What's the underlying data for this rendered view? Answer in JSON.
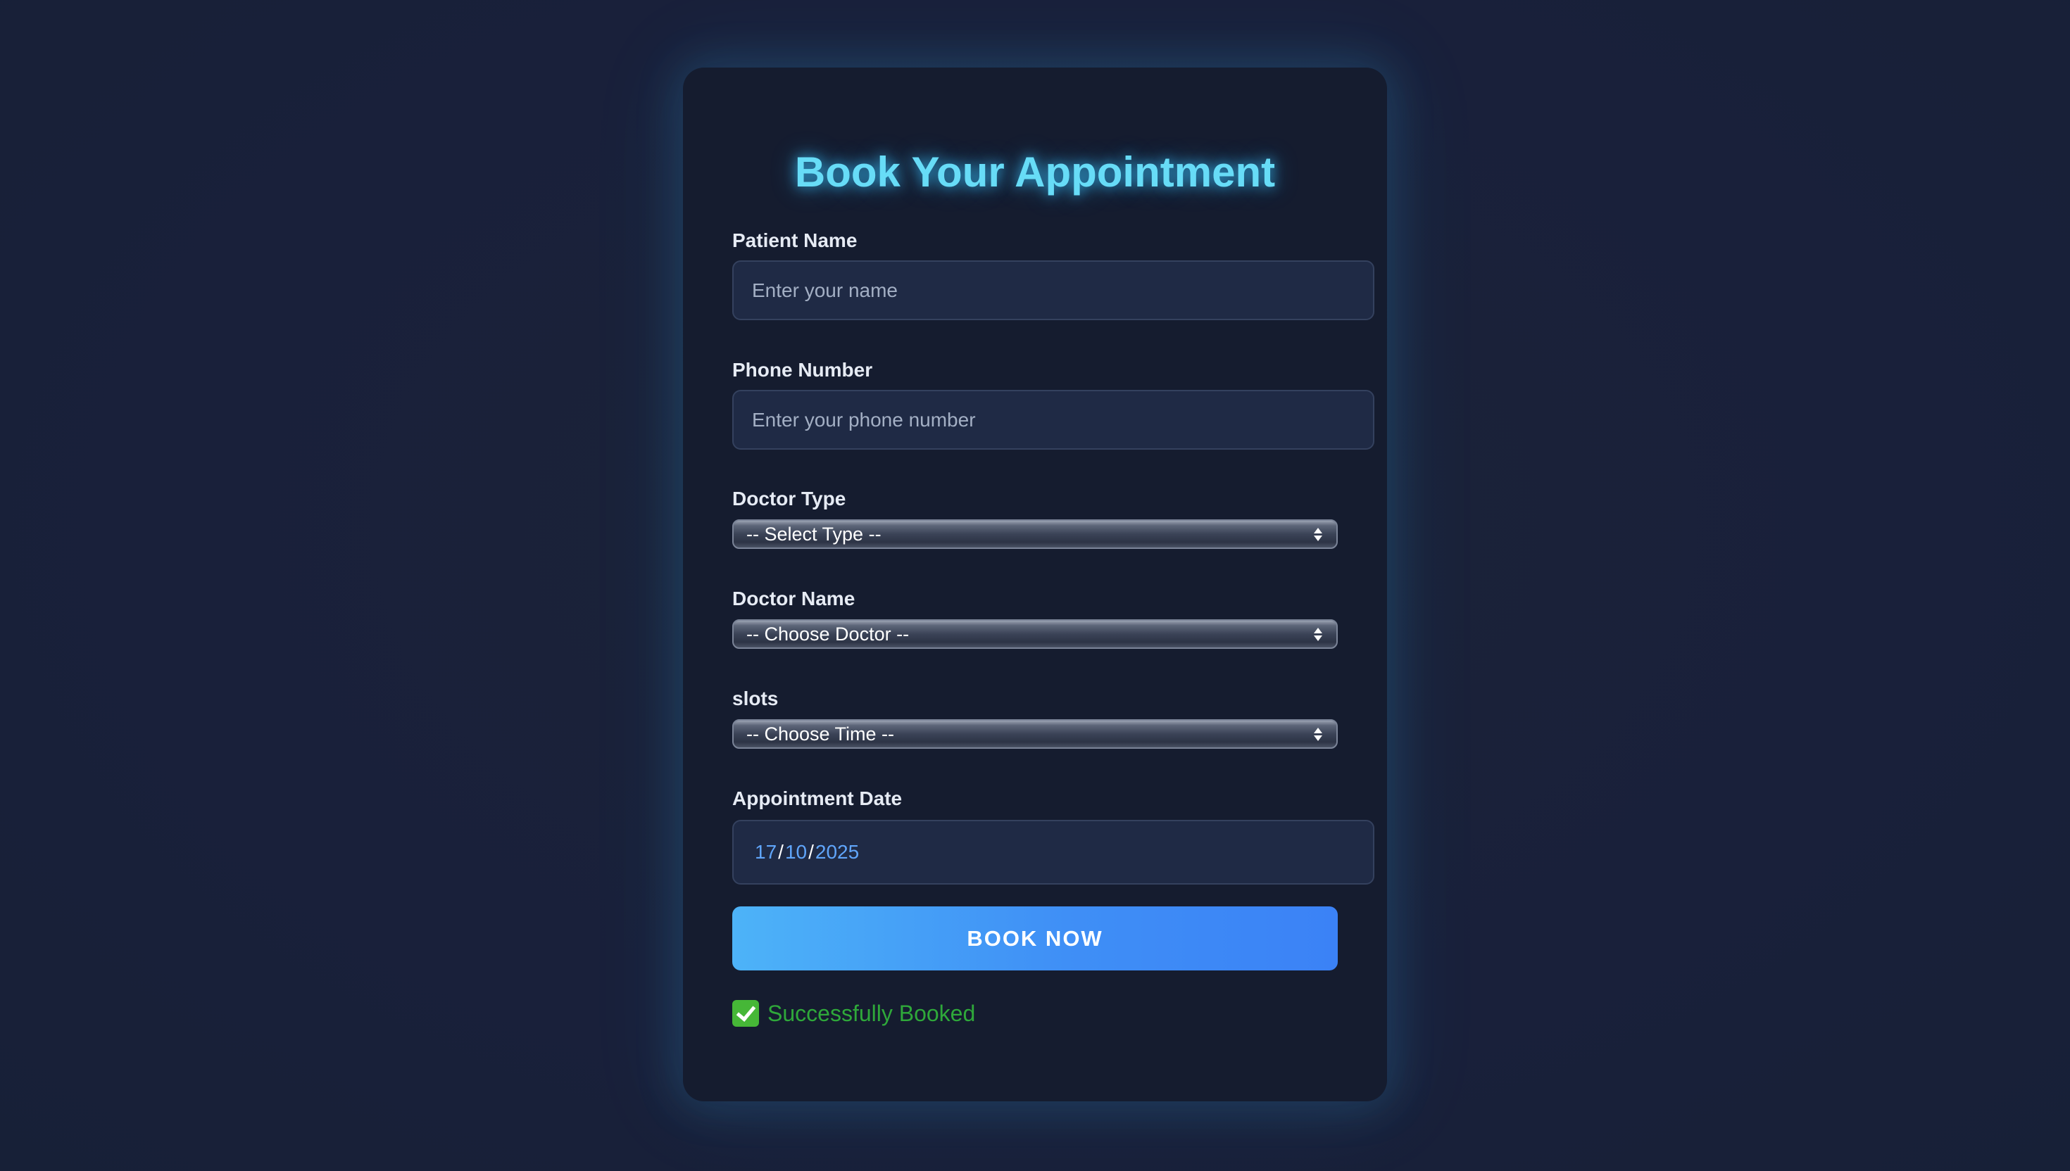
{
  "form": {
    "title": "Book Your Appointment",
    "patient_name": {
      "label": "Patient Name",
      "value": "",
      "placeholder": "Enter your name"
    },
    "phone_number": {
      "label": "Phone Number",
      "value": "",
      "placeholder": "Enter your phone number"
    },
    "doctor_type": {
      "label": "Doctor Type",
      "selected": "-- Select Type --"
    },
    "doctor_name": {
      "label": "Doctor Name",
      "selected": "-- Choose Doctor --"
    },
    "slots": {
      "label": "slots",
      "selected": "-- Choose Time --"
    },
    "appointment_date": {
      "label": "Appointment Date",
      "day": "17",
      "month": "10",
      "year": "2025",
      "separator": "/"
    },
    "submit_label": "BOOK NOW",
    "status": {
      "text": "Successfully Booked",
      "icon": "check-mark-icon",
      "color": "#2fa83a"
    }
  },
  "colors": {
    "background": "#19213a",
    "card": "#151c2f",
    "title_glow": "#67dcf7",
    "button_start": "#4db3f8",
    "button_end": "#3b82f6",
    "date_digits": "#60a5fa"
  }
}
